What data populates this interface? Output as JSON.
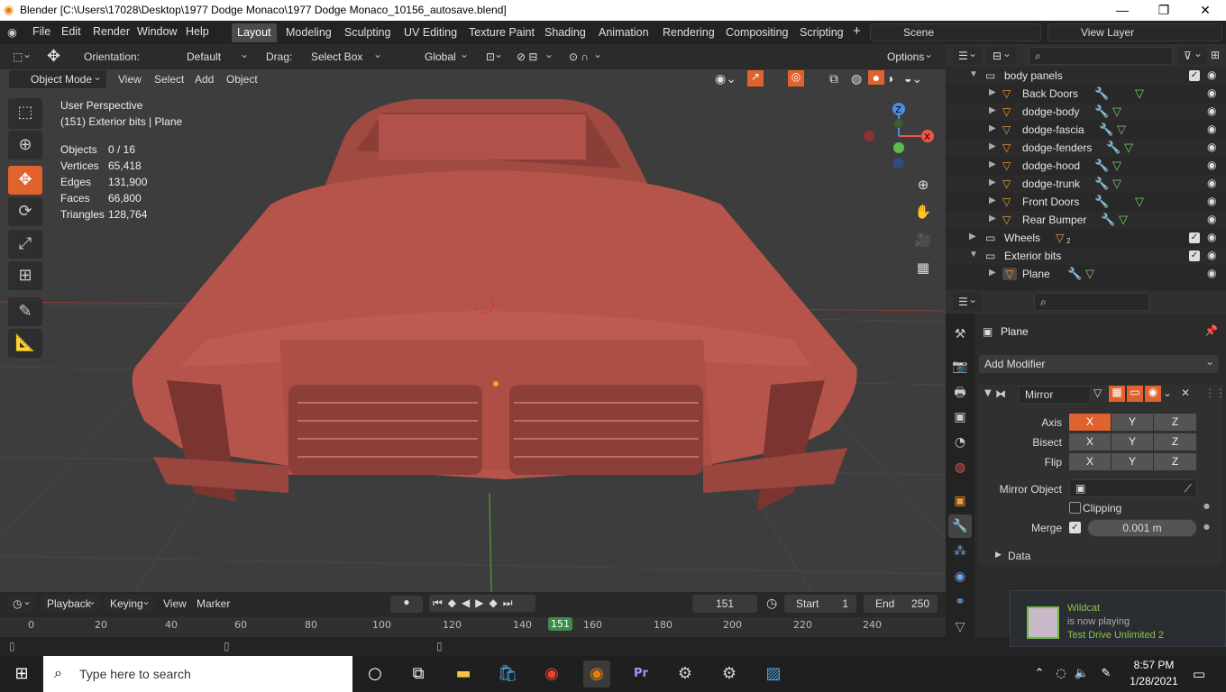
{
  "window": {
    "title": "Blender [C:\\Users\\17028\\Desktop\\1977 Dodge Monaco\\1977 Dodge Monaco_10156_autosave.blend]"
  },
  "menu": [
    "File",
    "Edit",
    "Render",
    "Window",
    "Help"
  ],
  "workspaces": [
    "Layout",
    "Modeling",
    "Sculpting",
    "UV Editing",
    "Texture Paint",
    "Shading",
    "Animation",
    "Rendering",
    "Compositing",
    "Scripting"
  ],
  "scene": "Scene",
  "view_layer": "View Layer",
  "toolbar": {
    "orientation_label": "Orientation:",
    "orientation_value": "Default",
    "drag_label": "Drag:",
    "drag_value": "Select Box",
    "transform_value": "Global",
    "options": "Options"
  },
  "viewport_header": {
    "mode": "Object Mode",
    "view": "View",
    "select": "Select",
    "add": "Add",
    "object": "Object"
  },
  "viewport_info": {
    "perspective": "User Perspective",
    "context": "(151) Exterior bits | Plane",
    "stats": [
      {
        "label": "Objects",
        "value": "0 / 16"
      },
      {
        "label": "Vertices",
        "value": "65,418"
      },
      {
        "label": "Edges",
        "value": "131,900"
      },
      {
        "label": "Faces",
        "value": "66,800"
      },
      {
        "label": "Triangles",
        "value": "128,764"
      }
    ]
  },
  "outliner": {
    "collection": "body panels",
    "items": [
      "Back Doors",
      "dodge-body",
      "dodge-fascia",
      "dodge-fenders",
      "dodge-hood",
      "dodge-trunk",
      "Front Doors",
      "Rear Bumper"
    ],
    "wheels": "Wheels",
    "wheels_count": "2",
    "exterior": "Exterior bits",
    "plane": "Plane"
  },
  "properties": {
    "object": "Plane",
    "add_modifier": "Add Modifier",
    "modifier_name": "Mirror",
    "axis_label": "Axis",
    "bisect_label": "Bisect",
    "flip_label": "Flip",
    "xyz": [
      "X",
      "Y",
      "Z"
    ],
    "mirror_object_label": "Mirror Object",
    "clipping": "Clipping",
    "merge_label": "Merge",
    "merge_value": "0.001 m",
    "data": "Data"
  },
  "timeline": {
    "playback": "Playback",
    "keying": "Keying",
    "view": "View",
    "marker": "Marker",
    "current_frame": "151",
    "start_label": "Start",
    "start": "1",
    "end_label": "End",
    "end": "250",
    "ticks": [
      "0",
      "20",
      "40",
      "60",
      "80",
      "100",
      "120",
      "140",
      "151",
      "160",
      "180",
      "200",
      "220",
      "240"
    ]
  },
  "notification": {
    "name": "Wildcat",
    "status": "is now playing",
    "game": "Test Drive Unlimited 2"
  },
  "taskbar": {
    "search_placeholder": "Type here to search",
    "time": "8:57 PM",
    "date": "1/28/2021"
  },
  "colors": {
    "accent": "#e0622d",
    "car": "#b5544a",
    "viewport": "#3d3d3d"
  }
}
